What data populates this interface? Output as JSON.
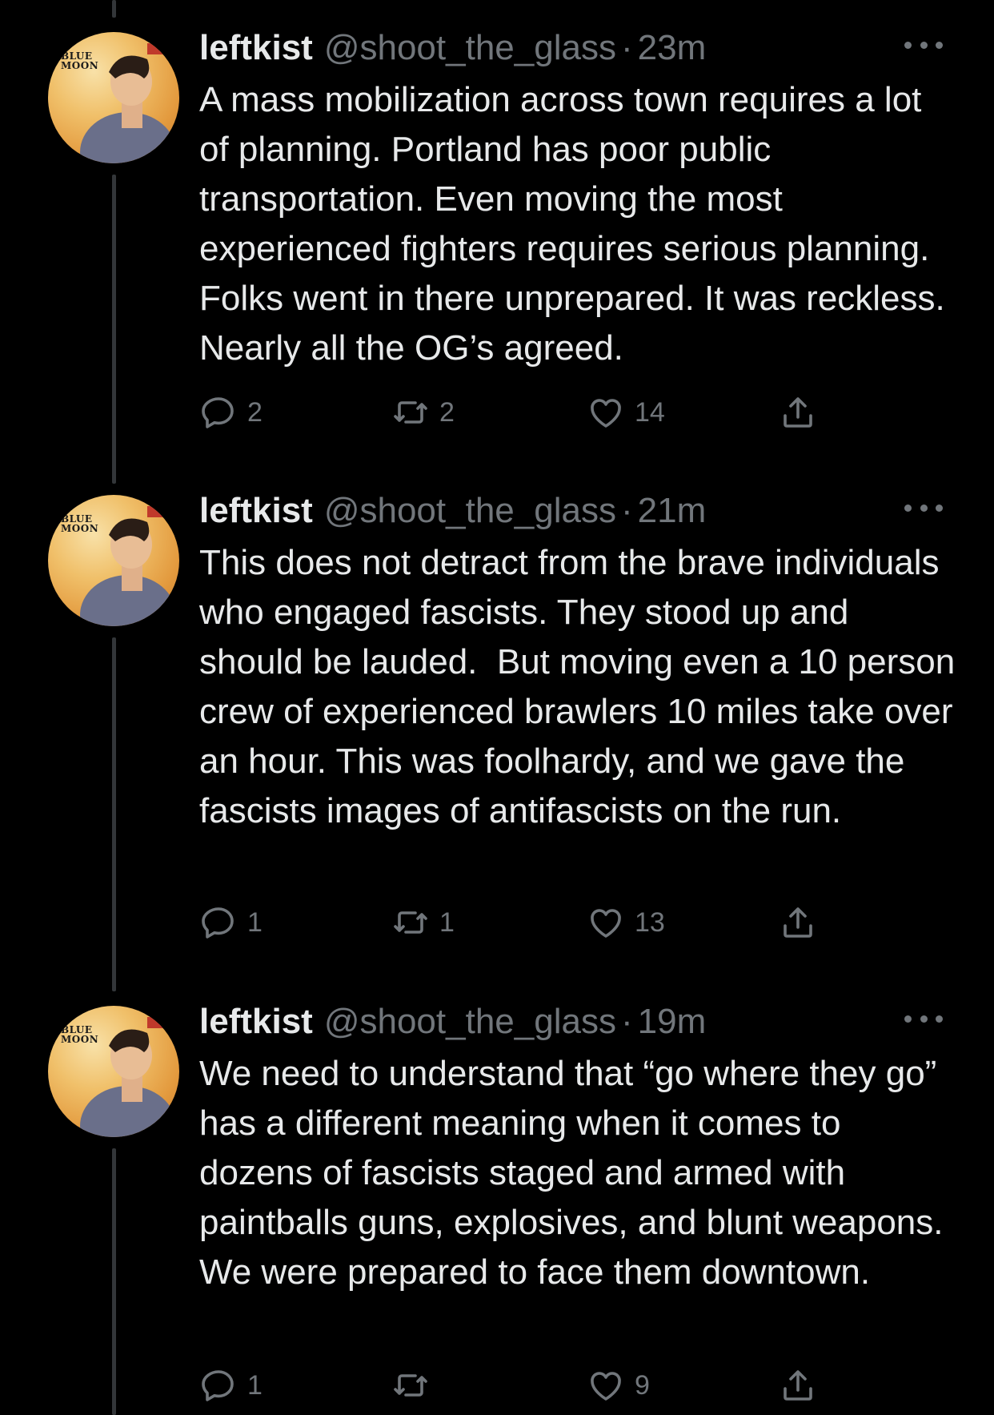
{
  "tweets": [
    {
      "avatar_text": "BLUE MOON",
      "name": "leftkist",
      "handle": "@shoot_the_glass",
      "separator": "·",
      "time": "23m",
      "text": "A mass mobilization across town requires a lot of planning. Portland has poor public transportation. Even moving the most experienced fighters requires serious planning. Folks went in there unprepared. It was reckless. Nearly all the OG’s agreed.",
      "replies": "2",
      "retweets": "2",
      "likes": "14"
    },
    {
      "avatar_text": "BLUE MOON",
      "name": "leftkist",
      "handle": "@shoot_the_glass",
      "separator": "·",
      "time": "21m",
      "text": "This does not detract from the brave individuals who engaged fascists. They stood up and should be lauded.  But moving even a 10 person crew of experienced brawlers 10 miles take over an hour. This was foolhardy, and we gave the fascists images of antifascists on the run.",
      "replies": "1",
      "retweets": "1",
      "likes": "13"
    },
    {
      "avatar_text": "BLUE MOON",
      "name": "leftkist",
      "handle": "@shoot_the_glass",
      "separator": "·",
      "time": "19m",
      "text": "We need to understand that “go where they go” has a different meaning when it comes to dozens of fascists staged and armed with paintballs guns, explosives, and blunt weapons. We were prepared to face them downtown.",
      "replies": "1",
      "retweets": "",
      "likes": "9"
    }
  ],
  "icons": {
    "reply": "reply-icon",
    "retweet": "retweet-icon",
    "like": "heart-icon",
    "share": "share-icon",
    "more": "more-icon"
  },
  "colors": {
    "background": "#000000",
    "text": "#e7e9ea",
    "muted": "#71767b",
    "thread_line": "#333639"
  }
}
